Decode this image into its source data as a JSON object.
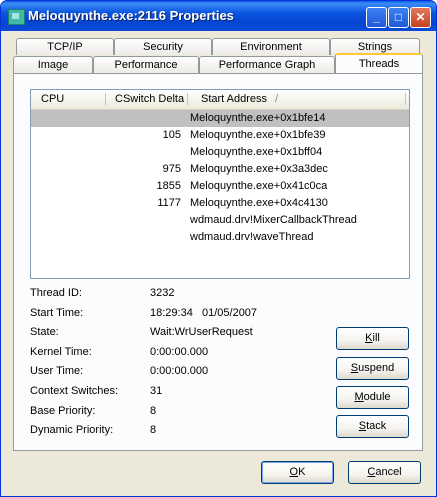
{
  "window": {
    "title": "Meloquynthe.exe:2116 Properties"
  },
  "title_buttons": {
    "minimize": "_",
    "maximize": "□",
    "close": "✕"
  },
  "tabs_row1": [
    "TCP/IP",
    "Security",
    "Environment",
    "Strings"
  ],
  "tabs_row2": [
    "Image",
    "Performance",
    "Performance Graph",
    "Threads"
  ],
  "active_tab": "Threads",
  "thread_list": {
    "columns": [
      "CPU",
      "CSwitch Delta",
      "Start Address"
    ],
    "sort_indicator": "/",
    "rows": [
      {
        "cpu": "",
        "cswitch": "",
        "address": "Meloquynthe.exe+0x1bfe14",
        "selected": true
      },
      {
        "cpu": "",
        "cswitch": "105",
        "address": "Meloquynthe.exe+0x1bfe39"
      },
      {
        "cpu": "",
        "cswitch": "",
        "address": "Meloquynthe.exe+0x1bff04"
      },
      {
        "cpu": "",
        "cswitch": "975",
        "address": "Meloquynthe.exe+0x3a3dec"
      },
      {
        "cpu": "",
        "cswitch": "1855",
        "address": "Meloquynthe.exe+0x41c0ca"
      },
      {
        "cpu": "",
        "cswitch": "1177",
        "address": "Meloquynthe.exe+0x4c4130"
      },
      {
        "cpu": "",
        "cswitch": "",
        "address": "wdmaud.drv!MixerCallbackThread"
      },
      {
        "cpu": "",
        "cswitch": "",
        "address": "wdmaud.drv!waveThread"
      }
    ]
  },
  "details": {
    "thread_id": {
      "label": "Thread ID:",
      "value": "3232"
    },
    "start_time": {
      "label": "Start Time:",
      "value": "18:29:34   01/05/2007"
    },
    "state": {
      "label": "State:",
      "value": "Wait:WrUserRequest"
    },
    "kernel_time": {
      "label": "Kernel Time:",
      "value": "0:00:00.000"
    },
    "user_time": {
      "label": "User Time:",
      "value": "0:00:00.000"
    },
    "context_switches": {
      "label": "Context Switches:",
      "value": "31"
    },
    "base_priority": {
      "label": "Base Priority:",
      "value": "8"
    },
    "dynamic_priority": {
      "label": "Dynamic Priority:",
      "value": "8"
    }
  },
  "side_buttons": {
    "kill": {
      "pre": "",
      "u": "K",
      "post": "ill"
    },
    "suspend": {
      "pre": "",
      "u": "S",
      "post": "uspend"
    },
    "module": {
      "pre": "",
      "u": "M",
      "post": "odule"
    },
    "stack": {
      "pre": "",
      "u": "S",
      "post": "tack"
    }
  },
  "dialog_buttons": {
    "ok": {
      "pre": "",
      "u": "O",
      "post": "K"
    },
    "cancel": {
      "pre": "",
      "u": "C",
      "post": "ancel"
    }
  },
  "colors": {
    "title_bar": "#0a4ad6",
    "dialog_bg": "#ece9d8",
    "selection": "#c0c0c0",
    "tab_highlight": "#ffc83c"
  }
}
